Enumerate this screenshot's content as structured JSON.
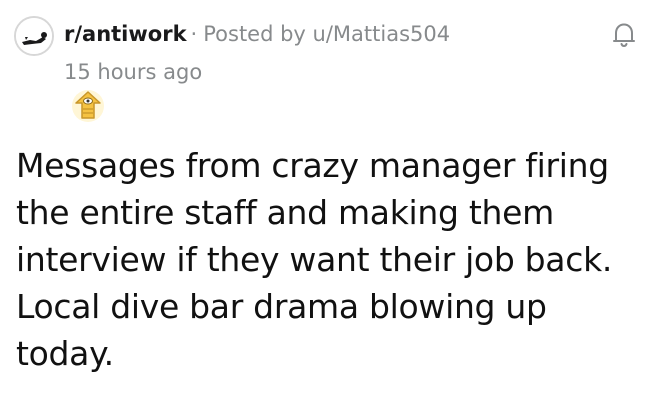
{
  "post": {
    "subreddit": "r/antiwork",
    "separator": "·",
    "posted_by_prefix": "Posted by",
    "username": "u/Mattias504",
    "timestamp": "15 hours ago",
    "title": "Messages from crazy manager firing the entire staff and making them interview if they want their job back. Local dive bar drama blowing up today."
  },
  "icons": {
    "subreddit_avatar": "antiwork-avatar-icon",
    "notify": "bell-icon",
    "award": "award-icon"
  },
  "colors": {
    "meta_gray": "#878a8c",
    "text": "#1a1a1b",
    "award_gold": "#f5c242"
  }
}
